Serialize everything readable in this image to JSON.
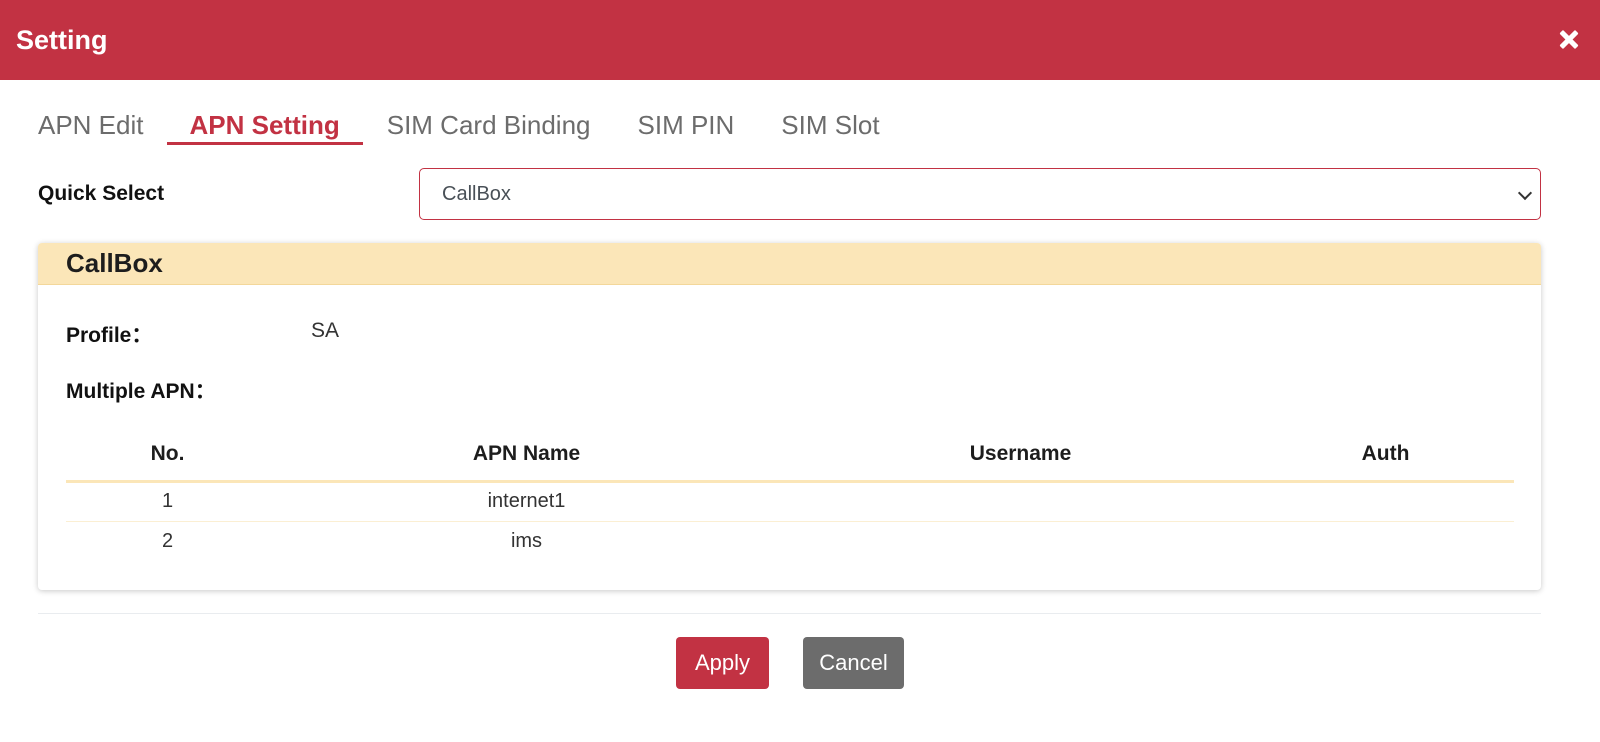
{
  "header": {
    "title": "Setting",
    "close_icon": "close-icon"
  },
  "tabs": [
    {
      "label": "APN Edit",
      "active": false
    },
    {
      "label": "APN Setting",
      "active": true
    },
    {
      "label": "SIM Card Binding",
      "active": false
    },
    {
      "label": "SIM PIN",
      "active": false
    },
    {
      "label": "SIM Slot",
      "active": false
    }
  ],
  "quick_select": {
    "label": "Quick Select",
    "value": "CallBox"
  },
  "card": {
    "title": "CallBox",
    "profile_label": "Profile：",
    "profile_value": "SA",
    "multiple_apn_label": "Multiple APN："
  },
  "table": {
    "headers": [
      "No.",
      "APN Name",
      "Username",
      "Auth"
    ],
    "rows": [
      [
        "1",
        "internet1",
        "",
        ""
      ],
      [
        "2",
        "ims",
        "",
        ""
      ]
    ]
  },
  "buttons": {
    "apply": "Apply",
    "cancel": "Cancel"
  },
  "colors": {
    "brand": "#c23243",
    "card_header": "#fbe6b8",
    "cancel": "#6c6c6c"
  }
}
